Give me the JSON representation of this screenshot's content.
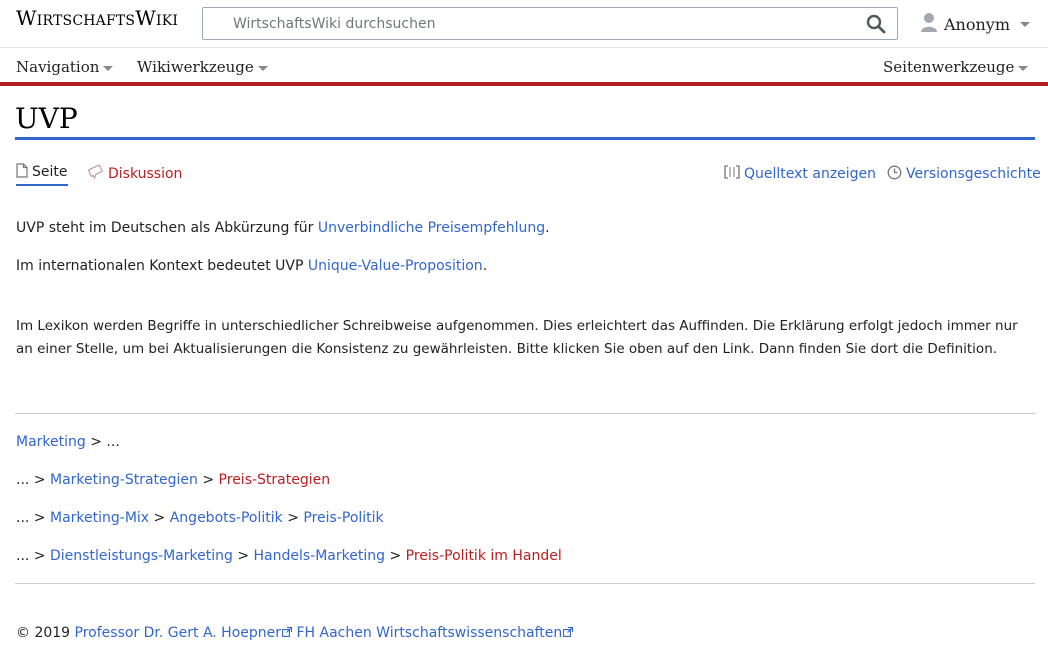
{
  "header": {
    "logo_big_w": "W",
    "logo_small_1": "IRTSCHAFTS",
    "logo_big_2": "W",
    "logo_small_2": "IKI",
    "search_placeholder": "WirtschaftsWiki durchsuchen",
    "search_icon": "search-icon",
    "user_label": "Anonym",
    "user_icon": "user-icon"
  },
  "nav": {
    "navigation": "Navigation",
    "wikiwerkzeuge": "Wikiwerkzeuge",
    "seitenwerkzeuge": "Seitenwerkzeuge"
  },
  "page": {
    "title": "UVP",
    "tabs": {
      "seite": "Seite",
      "diskussion": "Diskussion",
      "quelltext": "Quelltext anzeigen",
      "versionen": "Versionsgeschichte"
    },
    "p1_prefix": "UVP steht im Deutschen als Abkürzung für ",
    "p1_link": "Unverbindliche Preisempfehlung",
    "p1_suffix": ".",
    "p2_prefix": "Im internationalen Kontext bedeutet UVP ",
    "p2_link": "Unique-Value-Proposition",
    "p2_suffix": ".",
    "p3": "Im Lexikon werden Begriffe in unterschiedlicher Schreibweise aufgenommen. Dies erleichtert das Auffinden. Die Erklärung erfolgt jedoch immer nur an einer Stelle, um bei Aktualisierungen die Konsistenz zu gewährleisten. Bitte klicken Sie oben auf den Link. Dann finden Sie dort die Definition."
  },
  "breadcrumbs": {
    "row1": {
      "link1": "Marketing",
      "sep": " > ",
      "tail": "..."
    },
    "row2": {
      "head": "...",
      "sep": " > ",
      "link1": "Marketing-Strategien",
      "red1": "Preis-Strategien"
    },
    "row3": {
      "head": "...",
      "sep": " > ",
      "link1": "Marketing-Mix",
      "link2": "Angebots-Politik",
      "link3": "Preis-Politik"
    },
    "row4": {
      "head": "...",
      "sep": " > ",
      "link1": "Dienstleistungs-Marketing",
      "link2": "Handels-Marketing",
      "red1": "Preis-Politik im Handel"
    }
  },
  "footer": {
    "copyright": "© 2019 ",
    "author_link": "Professor Dr. Gert A. Hoepner",
    "space": " ",
    "org_link": "FH Aachen Wirtschaftswissenschaften"
  },
  "colors": {
    "link": "#3366cc",
    "redlink": "#ba2020",
    "nav_rule": "#b02020",
    "title_rule": "#3366cc"
  }
}
